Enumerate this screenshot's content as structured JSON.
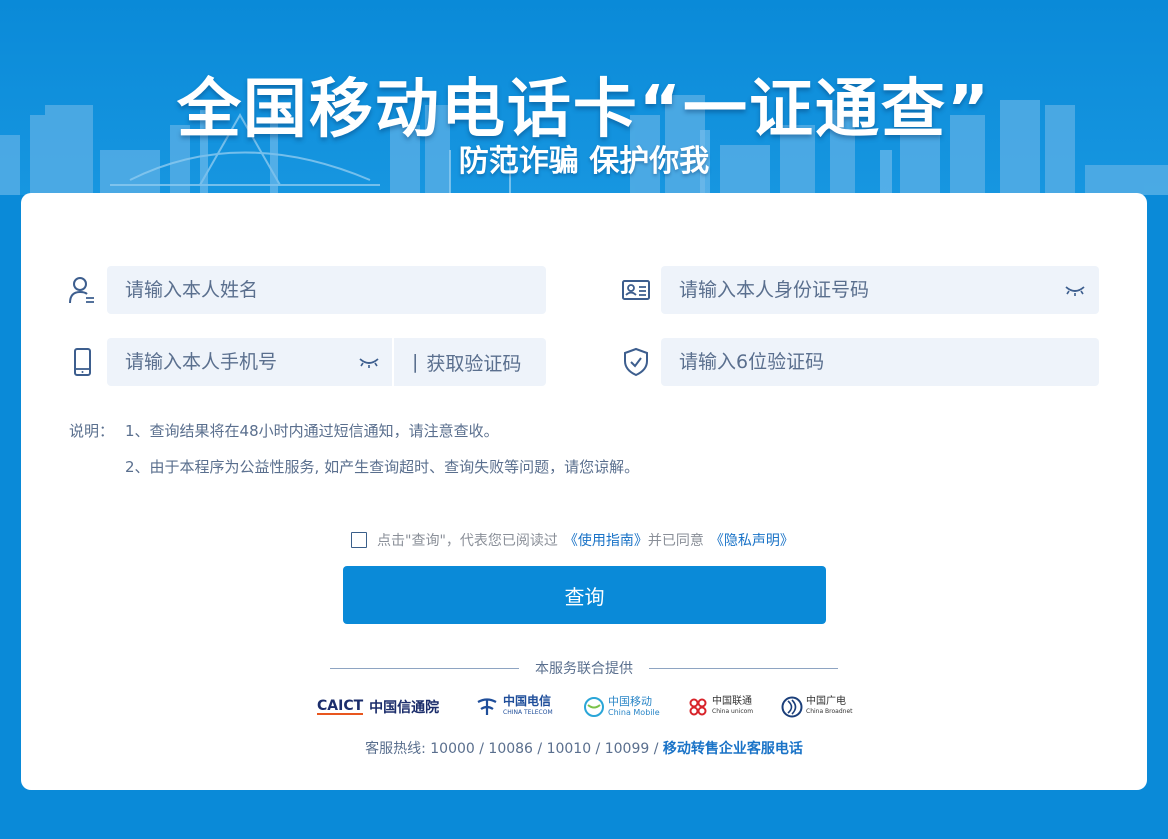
{
  "header": {
    "title": "全国移动电话卡“一证通查”",
    "subtitle": "防范诈骗 保护你我"
  },
  "form": {
    "name_placeholder": "请输入本人姓名",
    "id_placeholder": "请输入本人身份证号码",
    "phone_placeholder": "请输入本人手机号",
    "get_code_label": "获取验证码",
    "code_placeholder": "请输入6位验证码"
  },
  "notes": {
    "label": "说明：",
    "items": [
      "1、查询结果将在48小时内通过短信通知，请注意查收。",
      "2、由于本程序为公益性服务, 如产生查询超时、查询失败等问题，请您谅解。"
    ]
  },
  "agreement": {
    "prefix": "点击\"查询\"，代表您已阅读过",
    "guide_link": "《使用指南》",
    "middle": "并已同意",
    "privacy_link": "《隐私声明》",
    "checked": false
  },
  "query_button": "查询",
  "provided_by": "本服务联合提供",
  "providers": [
    {
      "name": "CAICT",
      "sub": "中国信通院",
      "icon": "caict-logo"
    },
    {
      "name": "中国电信",
      "sub": "CHINA TELECOM",
      "icon": "china-telecom-logo"
    },
    {
      "name": "中国移动",
      "sub": "China Mobile",
      "icon": "china-mobile-logo"
    },
    {
      "name": "中国联通",
      "sub": "China unicom",
      "icon": "china-unicom-logo"
    },
    {
      "name": "中国广电",
      "sub": "China Broadnet",
      "icon": "china-broadnet-logo"
    }
  ],
  "hotline": {
    "prefix": "客服热线: 10000 / 10086 / 10010 / 10099 /",
    "link": "移动转售企业客服电话"
  },
  "colors": {
    "brand_blue": "#0a8ad8",
    "input_bg": "#eef3fa",
    "link": "#1a73c7",
    "text_muted": "#5a6f8e"
  }
}
